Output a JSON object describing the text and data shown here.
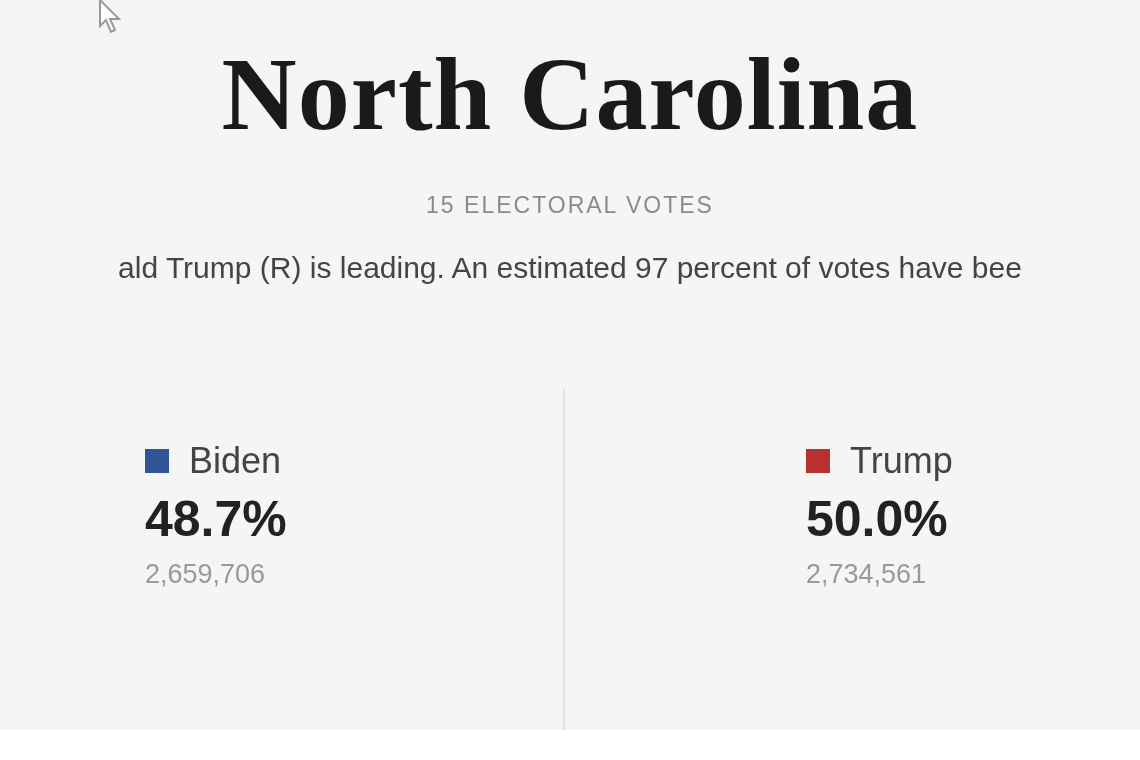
{
  "title": "North Carolina",
  "subtitle": "15 ELECTORAL VOTES",
  "summary": "ald Trump (R) is leading. An estimated 97 percent of votes have bee",
  "candidates": [
    {
      "name": "Biden",
      "color": "#2f5597",
      "percent": "48.7%",
      "votes": "2,659,706"
    },
    {
      "name": "Trump",
      "color": "#b8312f",
      "percent": "50.0%",
      "votes": "2,734,561"
    }
  ]
}
